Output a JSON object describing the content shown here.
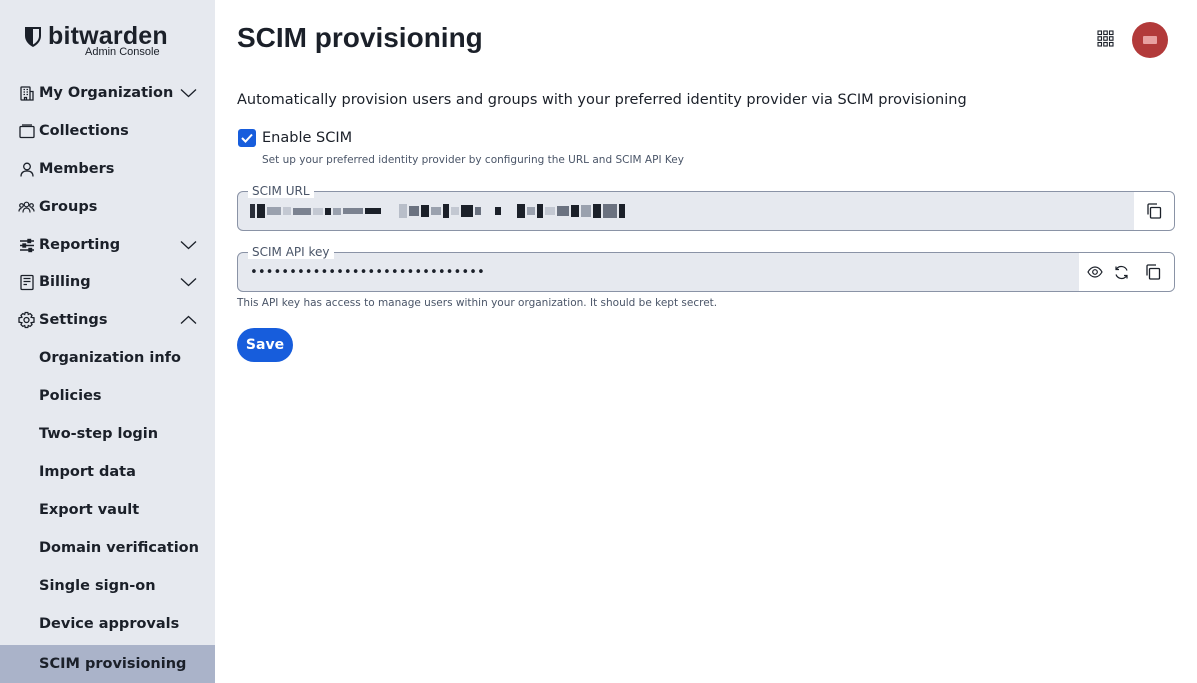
{
  "brand": {
    "name": "bitwarden",
    "subtitle": "Admin Console"
  },
  "sidebar": {
    "items": [
      {
        "label": "My Organization",
        "icon": "organization-icon",
        "expandable": true,
        "expanded": false
      },
      {
        "label": "Collections",
        "icon": "collections-icon",
        "expandable": false
      },
      {
        "label": "Members",
        "icon": "user-icon",
        "expandable": false
      },
      {
        "label": "Groups",
        "icon": "groups-icon",
        "expandable": false
      },
      {
        "label": "Reporting",
        "icon": "sliders-icon",
        "expandable": true,
        "expanded": false
      },
      {
        "label": "Billing",
        "icon": "billing-icon",
        "expandable": true,
        "expanded": false
      },
      {
        "label": "Settings",
        "icon": "gear-icon",
        "expandable": true,
        "expanded": true
      }
    ],
    "settings_subitems": [
      {
        "label": "Organization info"
      },
      {
        "label": "Policies"
      },
      {
        "label": "Two-step login"
      },
      {
        "label": "Import data"
      },
      {
        "label": "Export vault"
      },
      {
        "label": "Domain verification"
      },
      {
        "label": "Single sign-on"
      },
      {
        "label": "Device approvals"
      },
      {
        "label": "SCIM provisioning",
        "active": true
      }
    ]
  },
  "header": {
    "title": "SCIM provisioning",
    "apps_icon": "grid-icon",
    "avatar_color": "#b23a3a"
  },
  "main": {
    "description": "Automatically provision users and groups with your preferred identity provider via SCIM provisioning",
    "enable_scim": {
      "label": "Enable SCIM",
      "checked": true,
      "hint": "Set up your preferred identity provider by configuring the URL and SCIM API Key"
    },
    "scim_url": {
      "label": "SCIM URL"
    },
    "scim_api_key": {
      "label": "SCIM API key",
      "value": "••••••••••••••••••••••••••••••",
      "hint": "This API key has access to manage users within your organization. It should be kept secret."
    },
    "save_label": "Save"
  },
  "colors": {
    "accent": "#175ddc",
    "sidebar_bg": "#e6e9ef",
    "sidebar_active": "#aab3c9",
    "text": "#1b2029"
  }
}
